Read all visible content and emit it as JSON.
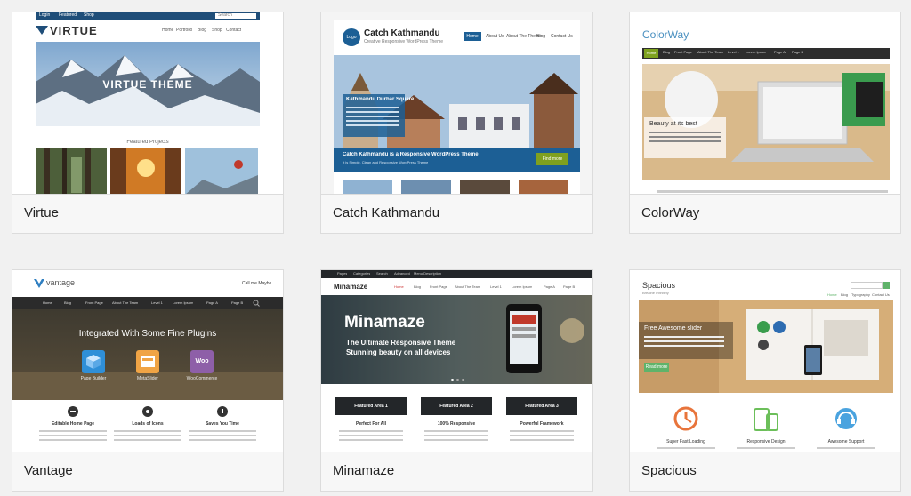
{
  "themes": [
    {
      "name": "Virtue",
      "preview": {
        "topbar": [
          "Login",
          "Featured",
          "Shop",
          "Search"
        ],
        "logo": "VIRTUE",
        "nav": [
          "Home",
          "Portfolio",
          "Blog",
          "Shop",
          "Contact"
        ],
        "hero_text": "VIRTUE THEME",
        "section_title": "Featured Projects"
      }
    },
    {
      "name": "Catch Kathmandu",
      "preview": {
        "logo_badge": "Logo",
        "site_title": "Catch Kathmandu",
        "tagline": "Creative Responsive WordPress Theme",
        "nav": [
          "Home",
          "About Us",
          "About The Theme",
          "Blog",
          "Contact Us"
        ],
        "caption_title": "Kathmandu Durbar Square",
        "banner_text": "Catch Kathmandu is a Responsive WordPress Theme",
        "banner_sub": "It is Simple, Clean and Responsive WordPress Theme",
        "button": "Find more"
      }
    },
    {
      "name": "ColorWay",
      "preview": {
        "logo": "ColorWay",
        "nav": [
          "Home",
          "Blog",
          "Front Page",
          "About The Team",
          "Level 1",
          "Lorem Ipsum",
          "Page A",
          "Page B"
        ],
        "caption_title": "Beauty at its best"
      }
    },
    {
      "name": "Vantage",
      "preview": {
        "logo": "vantage",
        "header_right": "Call me Maybe",
        "nav": [
          "Home",
          "Blog",
          "Front Page",
          "About The Team",
          "Level 1",
          "Lorem Ipsum",
          "Page A",
          "Page B"
        ],
        "hero_title": "Integrated With Some Fine Plugins",
        "plugins": [
          "Page Builder",
          "MetaSlider",
          "WooCommerce"
        ],
        "plugin_badge": "Woo",
        "features": [
          "Editable Home Page",
          "Loads of Icons",
          "Saves You Time"
        ]
      }
    },
    {
      "name": "Minamaze",
      "preview": {
        "topbar": [
          "Pages",
          "Categories",
          "Search",
          "Advanced",
          "Menu Description"
        ],
        "logo": "Minamaze",
        "nav": [
          "Home",
          "Blog",
          "Front Page",
          "About The Team",
          "Level 1",
          "Lorem Ipsum",
          "Page A",
          "Page B"
        ],
        "hero_title": "Minamaze",
        "hero_sub1": "The Ultimate Responsive Theme",
        "hero_sub2": "Stunning beauty on all devices",
        "areas": [
          "Featured Area 1",
          "Featured Area 2",
          "Featured Area 3"
        ],
        "area_titles": [
          "Perfect For All",
          "100% Responsive",
          "Powerful Framework"
        ]
      }
    },
    {
      "name": "Spacious",
      "preview": {
        "logo": "Spacious",
        "tagline": "Breathe Infinitely",
        "nav": [
          "Home",
          "Blog",
          "Typography",
          "Contact Us"
        ],
        "caption_title": "Free Awesome slider",
        "button": "Read more",
        "features": [
          "Super Fast Loading",
          "Responsive Design",
          "Awesome Support"
        ]
      }
    }
  ],
  "colors": {
    "page_bg": "#f1f1f1",
    "virtue_bar": "#1f4e79",
    "kathmandu_blue": "#1c5f95",
    "colorway_green": "#7ea21f",
    "vantage_dark": "#2b2b2b",
    "minamaze_dark": "#232629",
    "spacious_green": "#5fb36a"
  }
}
